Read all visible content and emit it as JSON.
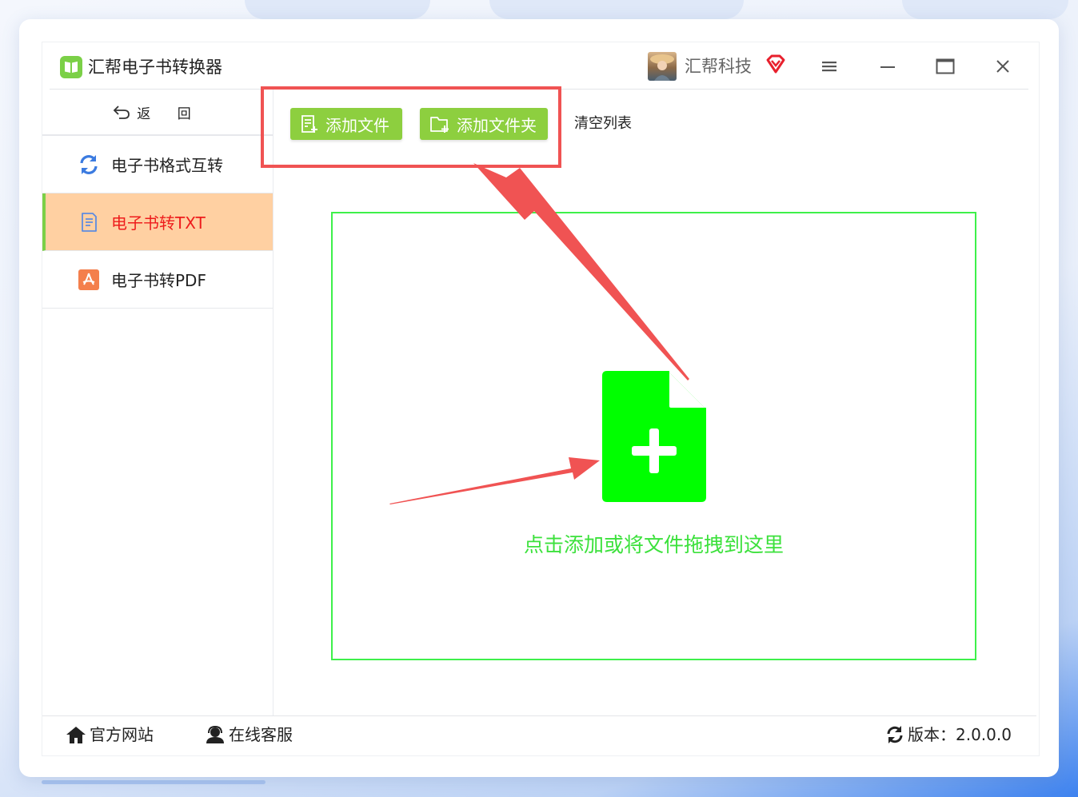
{
  "app": {
    "title": "汇帮电子书转换器",
    "company": "汇帮科技"
  },
  "window_controls": {
    "menu": "menu-icon",
    "minimize": "minimize-icon",
    "maximize": "maximize-icon",
    "close": "close-icon"
  },
  "sidebar": {
    "back_label": "返 回",
    "items": [
      {
        "label": "电子书格式互转",
        "icon": "refresh-icon",
        "active": false
      },
      {
        "label": "电子书转TXT",
        "icon": "document-icon",
        "active": true
      },
      {
        "label": "电子书转PDF",
        "icon": "pdf-icon",
        "active": false
      }
    ]
  },
  "toolbar": {
    "add_file": "添加文件",
    "add_folder": "添加文件夹",
    "clear_list": "清空列表"
  },
  "dropzone": {
    "hint": "点击添加或将文件拖拽到这里"
  },
  "footer": {
    "website": "官方网站",
    "support": "在线客服",
    "version_label": "版本：",
    "version": "2.0.0.0"
  },
  "colors": {
    "accent_green": "#8dcf3f",
    "drop_green": "#00ff00",
    "annotation_red": "#f05353",
    "active_bg": "#ffd0a2",
    "active_text": "#ee1c1c"
  }
}
